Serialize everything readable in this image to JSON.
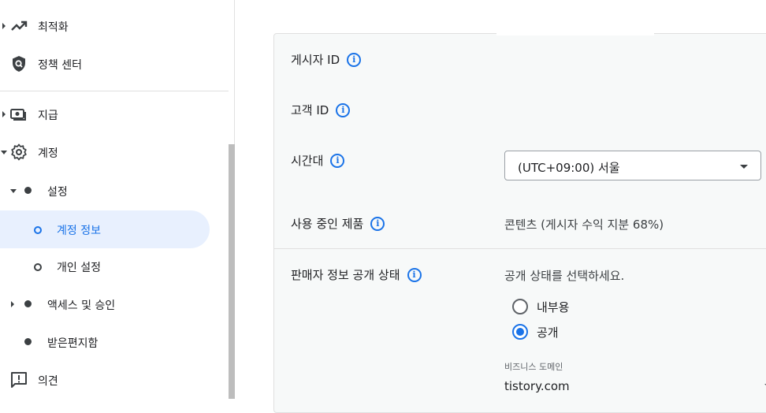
{
  "sidebar": {
    "optimization": "최적화",
    "policy_center": "정책 센터",
    "payments": "지급",
    "account": "계정",
    "settings": "설정",
    "account_info": "계정 정보",
    "personal_settings": "개인 설정",
    "access_approval": "액세스 및 승인",
    "inbox": "받은편지함",
    "feedback": "의견"
  },
  "main": {
    "publisher_id_label": "게시자 ID",
    "customer_id_label": "고객 ID",
    "timezone_label": "시간대",
    "timezone_value": "(UTC+09:00) 서울",
    "products_label": "사용 중인 제품",
    "products_value": "콘텐츠 (게시자 수익 지분 68%)",
    "seller_status_label": "판매자 정보 공개 상태",
    "seller_status_prompt": "공개 상태를 선택하세요.",
    "option_internal": "내부용",
    "option_public": "공개",
    "selected_option": "공개",
    "business_domain_label": "비즈니스 도메인",
    "business_domain_value": "tistory.com"
  },
  "colors": {
    "accent": "#1a73e8",
    "active_bg": "#e8f0fe",
    "card_bg": "#f7f9f9"
  }
}
